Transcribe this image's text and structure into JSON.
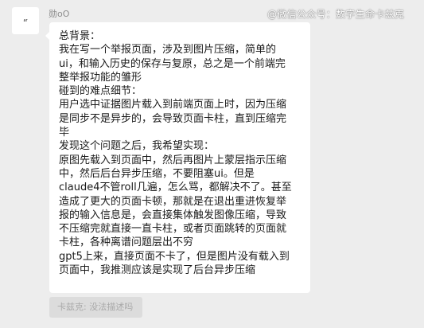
{
  "sender": {
    "avatar_text": "ar",
    "name": "勋oO"
  },
  "watermark": "@微信公众号：数字生命卡兹克",
  "message": {
    "lines": [
      "总背景：",
      "我在写一个举报页面，涉及到图片压缩，简单的",
      "ui，和输入历史的保存与复原，总之是一个前端完",
      "整举报功能的雏形",
      "碰到的难点细节：",
      "用户选中证据图片载入到前端页面上时，因为压缩",
      "是同步不是异步的，会导致页面卡柱，直到压缩完",
      "毕",
      "发现这个问题之后，我希望实现：",
      "原图先载入到页面中，然后再图片上蒙层指示压缩",
      "中，然后后台异步压缩，不要阻塞ui。但是",
      "claude4不管roll几遍，怎么骂，都解决不了。甚至",
      "造成了更大的页面卡顿，那就是在退出重进恢复举",
      "报的输入信息是，会直接集体触发图像压缩，导致",
      "不压缩完就直接一直卡柱，或者页面跳转的页面就",
      "卡柱，各种离谱问题层出不穷",
      "gpt5上来，直接页面不卡了，但是图片没有载入到",
      "页面中，我推测应该是实现了后台异步压缩"
    ]
  },
  "quote": {
    "text": "卡兹克: 没法描述吗"
  }
}
